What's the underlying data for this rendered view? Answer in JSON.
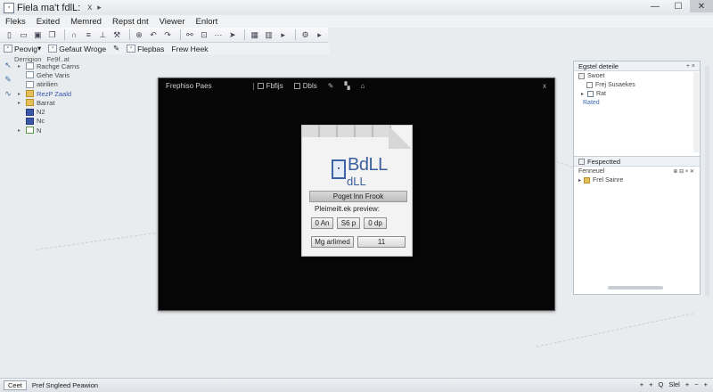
{
  "window": {
    "title": "Fiela ma't fdlL:",
    "tab_close": "x",
    "pin": "▸",
    "min": "—",
    "max": "☐",
    "close": "✕"
  },
  "menu": [
    "Fleks",
    "Exited",
    "Memred",
    "Repst dnt",
    "Viewer",
    "Enlort"
  ],
  "toolbar2": {
    "item1": "Peovig",
    "item2": "Gefaut Wroge",
    "item3": "",
    "item4": "Flepbas",
    "item5": "Frew Heek"
  },
  "tabstrip": [
    "Derrigion",
    "Fe9f..at"
  ],
  "tree": [
    {
      "label": "Rachge Carns",
      "icon": "doc"
    },
    {
      "label": "Gehe Varis",
      "icon": "doc"
    },
    {
      "label": "atirilien",
      "icon": "doc"
    },
    {
      "label": "RezP Zaald",
      "icon": "folder"
    },
    {
      "label": "Barrat",
      "icon": "folder"
    },
    {
      "label": "N2",
      "icon": "blue"
    },
    {
      "label": "Nc",
      "icon": "blue"
    },
    {
      "label": "N",
      "icon": "green"
    }
  ],
  "dark_panel": {
    "title": "Frephiso Paes",
    "tool1": "Fbfijs",
    "tool2": "Dbls",
    "close": "x"
  },
  "doc_card": {
    "logo": "▪",
    "big": "BdLL",
    "small": "dLL",
    "bar_label": "Poget lnn Frook",
    "preview_label": "Pleimeilt.ek preview:",
    "btn1": "0 An",
    "btn2": "S6 p",
    "btn3": "0 dp",
    "btn4": "Mg arlimed",
    "btn5": "11"
  },
  "right_panel": {
    "header": "Egstel deteile",
    "ctrls": "+ ×",
    "row1": "Swoet",
    "row2": "Frej Susaekes",
    "row3": "Rat",
    "row4": "Rated",
    "lower_header": "Fespectted",
    "lower_row1": "Fenneuel",
    "lower_row2": "Frel Sainre",
    "lower_ctrls": "⊕ ⊟ × ✕"
  },
  "status": {
    "button": "Ceet",
    "text": "Pref Sngleed Peawion",
    "right": [
      "+",
      "+",
      "Q",
      "Slel",
      "+",
      "−",
      "+"
    ]
  }
}
